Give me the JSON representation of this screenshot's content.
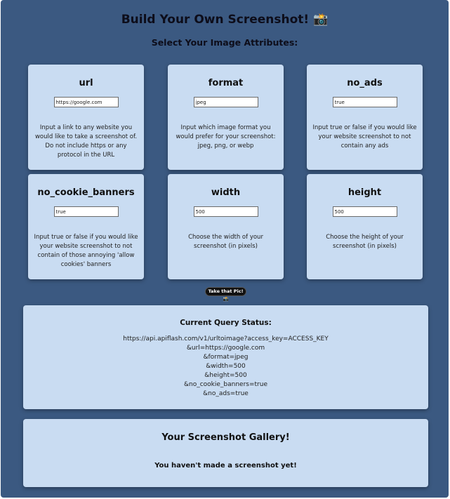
{
  "header": {
    "title": "Build Your Own Screenshot! 📸",
    "subtitle": "Select Your Image Attributes:"
  },
  "attributes": [
    {
      "name": "url",
      "value": "https://google.com",
      "description": "Input a link to any website you would like to take a screenshot of. Do not include https or any protocol in the URL"
    },
    {
      "name": "format",
      "value": "jpeg",
      "description": "Input which image format you would prefer for your screenshot: jpeg, png, or webp"
    },
    {
      "name": "no_ads",
      "value": "true",
      "description": "Input true or false if you would like your website screenshot to not contain any ads"
    },
    {
      "name": "no_cookie_banners",
      "value": "true",
      "description": "Input true or false if you would like your website screenshot to not contain of those annoying 'allow cookies' banners"
    },
    {
      "name": "width",
      "value": "500",
      "description": "Choose the width of your screenshot (in pixels)"
    },
    {
      "name": "height",
      "value": "500",
      "description": "Choose the height of your screenshot (in pixels)"
    }
  ],
  "action": {
    "take_pic_label": "Take that Pic! 📸"
  },
  "status": {
    "title": "Current Query Status:",
    "lines": [
      "https://api.apiflash.com/v1/urltoimage?access_key=ACCESS_KEY",
      "&url=https://google.com",
      "&format=jpeg",
      "&width=500",
      "&height=500",
      "&no_cookie_banners=true",
      "&no_ads=true"
    ]
  },
  "gallery": {
    "title": "Your Screenshot Gallery!",
    "empty_message": "You haven't made a screenshot yet!"
  }
}
